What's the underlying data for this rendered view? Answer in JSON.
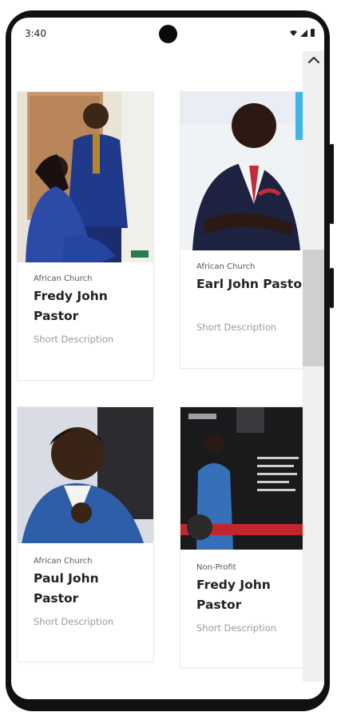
{
  "status_bar": {
    "time": "3:40"
  },
  "cards": [
    {
      "category": "African Church",
      "name": "Fredy John Pastor",
      "description": "Short Description"
    },
    {
      "category": "African Church",
      "name": "Earl John Pastor",
      "description": "Short Description"
    },
    {
      "category": "African Church",
      "name": "Paul John Pastor",
      "description": "Short Description"
    },
    {
      "category": "Non-Profit",
      "name": "Fredy John Pastor",
      "description": "Short Description"
    }
  ],
  "icons": {
    "scroll_up": "chevron-up-icon",
    "wifi": "wifi-icon",
    "signal": "signal-icon",
    "battery": "battery-icon"
  },
  "colors": {
    "text_dark": "#222222",
    "text_muted": "#9a9a9a",
    "scroll_track": "#efefef",
    "scroll_thumb": "#cfcfcf"
  }
}
